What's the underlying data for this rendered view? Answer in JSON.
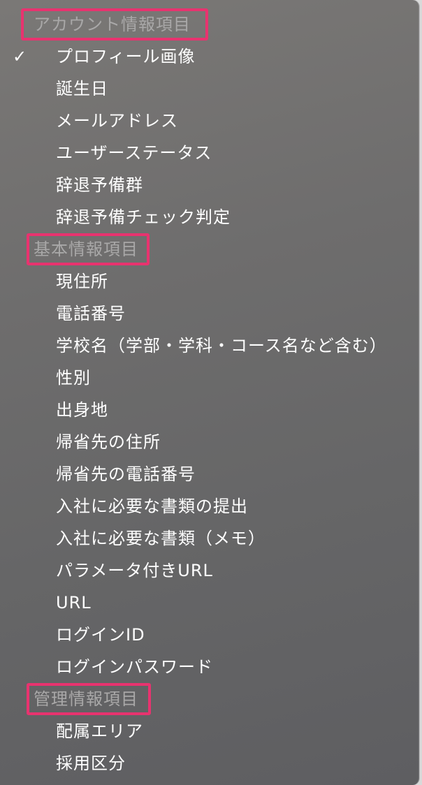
{
  "colors": {
    "highlight_box": "#e8336f",
    "section_header_text": "#a9a8a8",
    "item_text": "#ffffff"
  },
  "sections": [
    {
      "title": "アカウント情報項目",
      "items": [
        {
          "label": "プロフィール画像",
          "checked": true
        },
        {
          "label": "誕生日",
          "checked": false
        },
        {
          "label": "メールアドレス",
          "checked": false
        },
        {
          "label": "ユーザーステータス",
          "checked": false
        },
        {
          "label": "辞退予備群",
          "checked": false
        },
        {
          "label": "辞退予備チェック判定",
          "checked": false
        }
      ]
    },
    {
      "title": "基本情報項目",
      "items": [
        {
          "label": "現住所",
          "checked": false
        },
        {
          "label": "電話番号",
          "checked": false
        },
        {
          "label": "学校名（学部・学科・コース名など含む）",
          "checked": false
        },
        {
          "label": "性別",
          "checked": false
        },
        {
          "label": "出身地",
          "checked": false
        },
        {
          "label": "帰省先の住所",
          "checked": false
        },
        {
          "label": "帰省先の電話番号",
          "checked": false
        },
        {
          "label": "入社に必要な書類の提出",
          "checked": false
        },
        {
          "label": "入社に必要な書類（メモ）",
          "checked": false
        },
        {
          "label": "パラメータ付きURL",
          "checked": false
        },
        {
          "label": "URL",
          "checked": false
        },
        {
          "label": "ログインID",
          "checked": false
        },
        {
          "label": "ログインパスワード",
          "checked": false
        }
      ]
    },
    {
      "title": "管理情報項目",
      "items": [
        {
          "label": "配属エリア",
          "checked": false
        },
        {
          "label": "採用区分",
          "checked": false
        }
      ]
    }
  ]
}
